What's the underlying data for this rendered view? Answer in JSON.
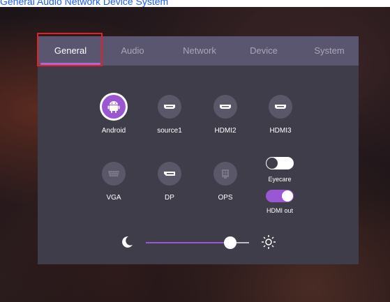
{
  "header_link_text": "General Audio Network Device System",
  "tabs": [
    {
      "label": "General",
      "active": true
    },
    {
      "label": "Audio",
      "active": false
    },
    {
      "label": "Network",
      "active": false
    },
    {
      "label": "Device",
      "active": false
    },
    {
      "label": "System",
      "active": false
    }
  ],
  "sources": [
    {
      "label": "Android",
      "icon": "android-icon",
      "active": true
    },
    {
      "label": "source1",
      "icon": "hdmi-port-icon",
      "active": false
    },
    {
      "label": "HDMI2",
      "icon": "hdmi-port-icon",
      "active": false
    },
    {
      "label": "HDMI3",
      "icon": "hdmi-port-icon",
      "active": false
    },
    {
      "label": "VGA",
      "icon": "vga-port-icon",
      "active": false
    },
    {
      "label": "DP",
      "icon": "displayport-icon",
      "active": false
    },
    {
      "label": "OPS",
      "icon": "ops-icon",
      "active": false
    }
  ],
  "toggles": [
    {
      "label": "Eyecare",
      "on": false
    },
    {
      "label": "HDMI out",
      "on": true
    }
  ],
  "brightness": {
    "value": 0.82,
    "min_icon": "moon-icon",
    "max_icon": "sun-icon"
  },
  "colors": {
    "accent": "#9b57d3",
    "panel": "#403d4a",
    "tabbar": "#5a5670",
    "highlight": "#e0222a"
  }
}
